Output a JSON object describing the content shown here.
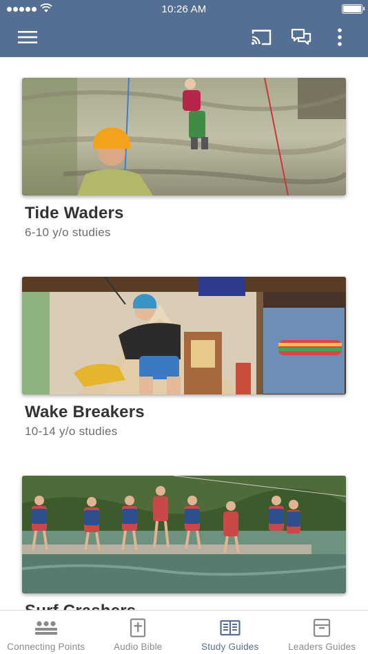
{
  "status_bar": {
    "time": "10:26 AM"
  },
  "app_bar": {
    "icons": [
      "menu-icon",
      "cast-icon",
      "chat-icon",
      "more-vertical-icon"
    ]
  },
  "cards": [
    {
      "title": "Tide Waders",
      "subtitle": "6-10 y/o studies"
    },
    {
      "title": "Wake Breakers",
      "subtitle": "10-14 y/o studies"
    },
    {
      "title": "Surf Crashers",
      "subtitle": ""
    }
  ],
  "bottom_nav": {
    "items": [
      {
        "label": "Connecting Points",
        "icon": "group-icon",
        "active": false
      },
      {
        "label": "Audio Bible",
        "icon": "bible-icon",
        "active": false
      },
      {
        "label": "Study Guides",
        "icon": "open-book-icon",
        "active": true
      },
      {
        "label": "Leaders Guides",
        "icon": "archive-box-icon",
        "active": false
      }
    ]
  },
  "colors": {
    "app_bar": "#546f93",
    "active_tab": "#546f93",
    "inactive_tab": "#8a8a8a",
    "title_text": "#333333",
    "subtitle_text": "#6b6b6b"
  }
}
